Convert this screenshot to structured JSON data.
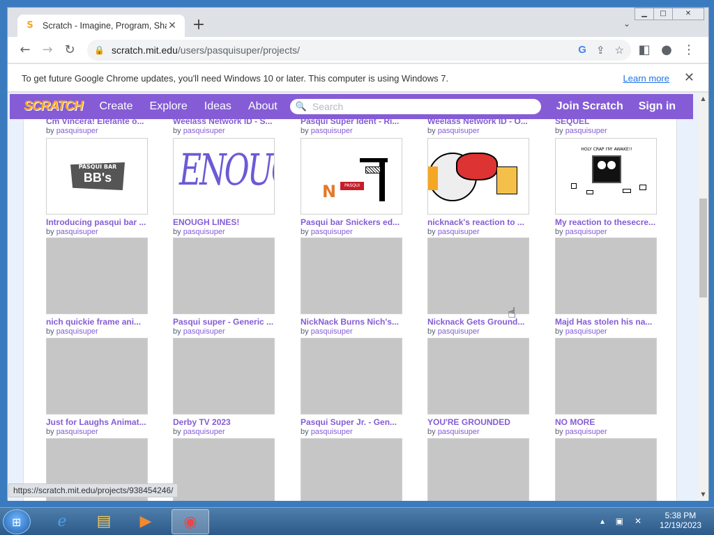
{
  "browser": {
    "tab_title": "Scratch - Imagine, Program, Shar",
    "tab_favicon": "S",
    "new_tab": "+",
    "url_host": "scratch.mit.edu",
    "url_path": "/users/pasquisuper/projects/",
    "infobar_message": "To get future Google Chrome updates, you'll need Windows 10 or later. This computer is using Windows 7.",
    "infobar_link": "Learn more",
    "status_url": "https://scratch.mit.edu/projects/938454246/"
  },
  "scratch_nav": {
    "logo": "SCRATCH",
    "create": "Create",
    "explore": "Explore",
    "ideas": "Ideas",
    "about": "About",
    "search_placeholder": "Search",
    "join": "Join Scratch",
    "signin": "Sign in"
  },
  "by_label": "by",
  "owner": "pasquisuper",
  "partial_row": [
    "Cm Vincera! Elefante o...",
    "Weelass Network ID - S...",
    "Pasqui Super Ident - Ri...",
    "Weelass Network ID - O...",
    "SEQUEL"
  ],
  "projects": [
    {
      "title": "Introducing pasqui bar ...",
      "thumb": "bbs"
    },
    {
      "title": "ENOUGH LINES!",
      "thumb": "enough"
    },
    {
      "title": "Pasqui bar Snickers ed...",
      "thumb": "snickers"
    },
    {
      "title": "nicknack's reaction to ...",
      "thumb": "reaction"
    },
    {
      "title": "My reaction to thesecre...",
      "thumb": "awake"
    },
    {
      "title": "nich quickie frame ani...",
      "thumb": "gray"
    },
    {
      "title": "Pasqui super - Generic ...",
      "thumb": "gray"
    },
    {
      "title": "NickNack Burns Nich's...",
      "thumb": "gray"
    },
    {
      "title": "Nicknack Gets Ground...",
      "thumb": "gray"
    },
    {
      "title": "Majd Has stolen his na...",
      "thumb": "gray"
    },
    {
      "title": "Just for Laughs Animat...",
      "thumb": "gray"
    },
    {
      "title": "Derby TV 2023",
      "thumb": "gray"
    },
    {
      "title": "Pasqui Super Jr. - Gen...",
      "thumb": "gray"
    },
    {
      "title": "YOU'RE GROUNDED",
      "thumb": "gray"
    },
    {
      "title": "NO MORE",
      "thumb": "gray"
    }
  ],
  "thumb_text": {
    "bbs_top": "PASQUI BAR",
    "bbs_main": "BB's",
    "enough": "ENOUGH!",
    "snickers": "PASQUI BAR",
    "awake": "HOLY CRAP I'M' AWAKE!!"
  },
  "taskbar": {
    "time": "5:38 PM",
    "date": "12/19/2023"
  },
  "colors": {
    "scratch_purple": "#855cd6",
    "thumb_gray": "#c6c6c6"
  }
}
